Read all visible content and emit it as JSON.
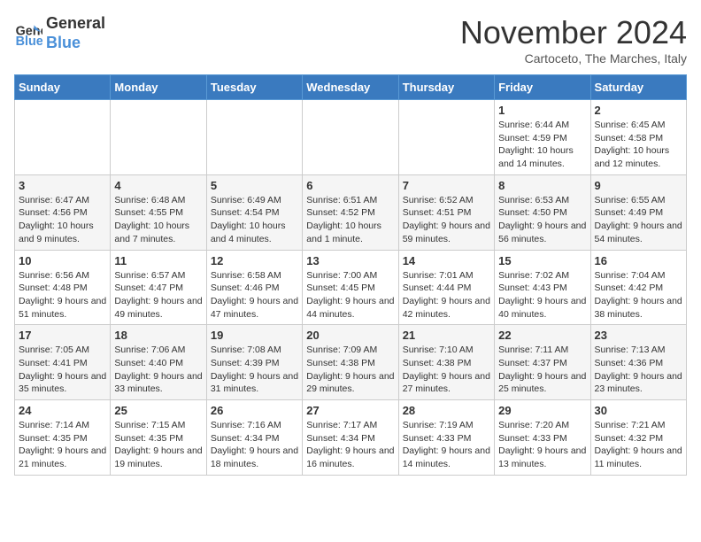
{
  "logo": {
    "line1": "General",
    "line2": "Blue"
  },
  "title": "November 2024",
  "location": "Cartoceto, The Marches, Italy",
  "weekdays": [
    "Sunday",
    "Monday",
    "Tuesday",
    "Wednesday",
    "Thursday",
    "Friday",
    "Saturday"
  ],
  "weeks": [
    [
      {
        "day": "",
        "info": ""
      },
      {
        "day": "",
        "info": ""
      },
      {
        "day": "",
        "info": ""
      },
      {
        "day": "",
        "info": ""
      },
      {
        "day": "",
        "info": ""
      },
      {
        "day": "1",
        "info": "Sunrise: 6:44 AM\nSunset: 4:59 PM\nDaylight: 10 hours and 14 minutes."
      },
      {
        "day": "2",
        "info": "Sunrise: 6:45 AM\nSunset: 4:58 PM\nDaylight: 10 hours and 12 minutes."
      }
    ],
    [
      {
        "day": "3",
        "info": "Sunrise: 6:47 AM\nSunset: 4:56 PM\nDaylight: 10 hours and 9 minutes."
      },
      {
        "day": "4",
        "info": "Sunrise: 6:48 AM\nSunset: 4:55 PM\nDaylight: 10 hours and 7 minutes."
      },
      {
        "day": "5",
        "info": "Sunrise: 6:49 AM\nSunset: 4:54 PM\nDaylight: 10 hours and 4 minutes."
      },
      {
        "day": "6",
        "info": "Sunrise: 6:51 AM\nSunset: 4:52 PM\nDaylight: 10 hours and 1 minute."
      },
      {
        "day": "7",
        "info": "Sunrise: 6:52 AM\nSunset: 4:51 PM\nDaylight: 9 hours and 59 minutes."
      },
      {
        "day": "8",
        "info": "Sunrise: 6:53 AM\nSunset: 4:50 PM\nDaylight: 9 hours and 56 minutes."
      },
      {
        "day": "9",
        "info": "Sunrise: 6:55 AM\nSunset: 4:49 PM\nDaylight: 9 hours and 54 minutes."
      }
    ],
    [
      {
        "day": "10",
        "info": "Sunrise: 6:56 AM\nSunset: 4:48 PM\nDaylight: 9 hours and 51 minutes."
      },
      {
        "day": "11",
        "info": "Sunrise: 6:57 AM\nSunset: 4:47 PM\nDaylight: 9 hours and 49 minutes."
      },
      {
        "day": "12",
        "info": "Sunrise: 6:58 AM\nSunset: 4:46 PM\nDaylight: 9 hours and 47 minutes."
      },
      {
        "day": "13",
        "info": "Sunrise: 7:00 AM\nSunset: 4:45 PM\nDaylight: 9 hours and 44 minutes."
      },
      {
        "day": "14",
        "info": "Sunrise: 7:01 AM\nSunset: 4:44 PM\nDaylight: 9 hours and 42 minutes."
      },
      {
        "day": "15",
        "info": "Sunrise: 7:02 AM\nSunset: 4:43 PM\nDaylight: 9 hours and 40 minutes."
      },
      {
        "day": "16",
        "info": "Sunrise: 7:04 AM\nSunset: 4:42 PM\nDaylight: 9 hours and 38 minutes."
      }
    ],
    [
      {
        "day": "17",
        "info": "Sunrise: 7:05 AM\nSunset: 4:41 PM\nDaylight: 9 hours and 35 minutes."
      },
      {
        "day": "18",
        "info": "Sunrise: 7:06 AM\nSunset: 4:40 PM\nDaylight: 9 hours and 33 minutes."
      },
      {
        "day": "19",
        "info": "Sunrise: 7:08 AM\nSunset: 4:39 PM\nDaylight: 9 hours and 31 minutes."
      },
      {
        "day": "20",
        "info": "Sunrise: 7:09 AM\nSunset: 4:38 PM\nDaylight: 9 hours and 29 minutes."
      },
      {
        "day": "21",
        "info": "Sunrise: 7:10 AM\nSunset: 4:38 PM\nDaylight: 9 hours and 27 minutes."
      },
      {
        "day": "22",
        "info": "Sunrise: 7:11 AM\nSunset: 4:37 PM\nDaylight: 9 hours and 25 minutes."
      },
      {
        "day": "23",
        "info": "Sunrise: 7:13 AM\nSunset: 4:36 PM\nDaylight: 9 hours and 23 minutes."
      }
    ],
    [
      {
        "day": "24",
        "info": "Sunrise: 7:14 AM\nSunset: 4:35 PM\nDaylight: 9 hours and 21 minutes."
      },
      {
        "day": "25",
        "info": "Sunrise: 7:15 AM\nSunset: 4:35 PM\nDaylight: 9 hours and 19 minutes."
      },
      {
        "day": "26",
        "info": "Sunrise: 7:16 AM\nSunset: 4:34 PM\nDaylight: 9 hours and 18 minutes."
      },
      {
        "day": "27",
        "info": "Sunrise: 7:17 AM\nSunset: 4:34 PM\nDaylight: 9 hours and 16 minutes."
      },
      {
        "day": "28",
        "info": "Sunrise: 7:19 AM\nSunset: 4:33 PM\nDaylight: 9 hours and 14 minutes."
      },
      {
        "day": "29",
        "info": "Sunrise: 7:20 AM\nSunset: 4:33 PM\nDaylight: 9 hours and 13 minutes."
      },
      {
        "day": "30",
        "info": "Sunrise: 7:21 AM\nSunset: 4:32 PM\nDaylight: 9 hours and 11 minutes."
      }
    ]
  ]
}
